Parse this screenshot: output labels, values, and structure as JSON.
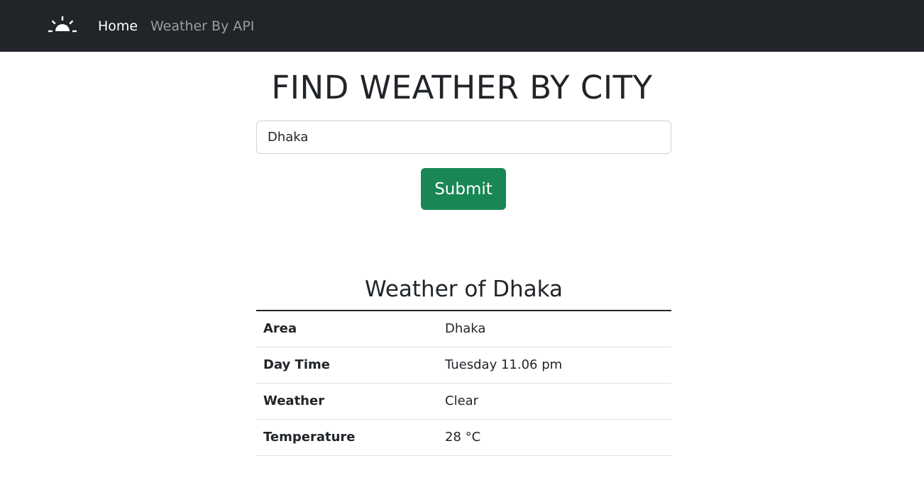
{
  "navbar": {
    "brand_icon": "sunrise-icon",
    "links": [
      {
        "label": "Home",
        "active": true
      },
      {
        "label": "Weather By API",
        "active": false
      }
    ]
  },
  "main": {
    "title": "FIND WEATHER BY CITY",
    "search": {
      "value": "Dhaka"
    },
    "submit_label": "Submit"
  },
  "result": {
    "heading": "Weather of Dhaka",
    "rows": [
      {
        "label": "Area",
        "value": "Dhaka"
      },
      {
        "label": "Day Time",
        "value": "Tuesday 11.06 pm"
      },
      {
        "label": "Weather",
        "value": "Clear"
      },
      {
        "label": "Temperature",
        "value": "28 °C"
      }
    ]
  },
  "colors": {
    "navbar_bg": "#212529",
    "submit_bg": "#198754",
    "text": "#212529"
  }
}
